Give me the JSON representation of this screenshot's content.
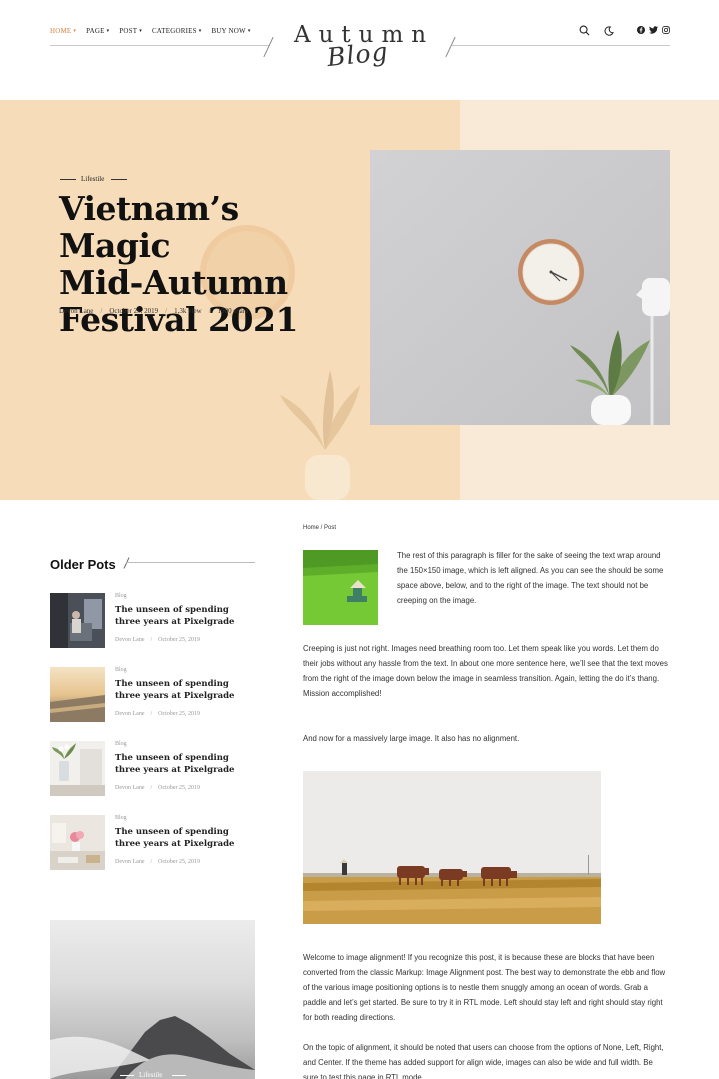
{
  "nav": {
    "items": [
      {
        "label": "HOME",
        "caret": "▾"
      },
      {
        "label": "PAGE",
        "caret": "▾"
      },
      {
        "label": "POST",
        "caret": "▾"
      },
      {
        "label": "CATEGORIES",
        "caret": "▾"
      },
      {
        "label": "BUY NOW",
        "caret": "▾"
      }
    ],
    "active_color": "#d9803e"
  },
  "logo": {
    "main": "Autumn",
    "script": "Blog"
  },
  "icons": {
    "search": "search-icon",
    "dark_mode": "moon-icon",
    "social": [
      "facebook-icon",
      "twitter-icon",
      "instagram-icon"
    ]
  },
  "hero": {
    "category": "Lifestile",
    "title_lines": [
      "Vietnam’s Magic",
      "Mid-Autumn",
      "Festival 2021"
    ],
    "author": "Devon Lane",
    "date": "October 25, 2019",
    "views": "1,3k view",
    "shares": "1900 share",
    "sep": "/",
    "colors": {
      "left_bg": "#f6dcb8",
      "right_bg": "#f8ead7"
    }
  },
  "sidebar": {
    "title": "Older Pots",
    "posts": [
      {
        "category": "Blog",
        "title": "The unseen of spending three years at Pixelgrade",
        "author": "Devon Lane",
        "sep": "/",
        "date": "October 25, 2019"
      },
      {
        "category": "Blog",
        "title": "The unseen of spending three years at Pixelgrade",
        "author": "Devon Lane",
        "sep": "/",
        "date": "October 25, 2019"
      },
      {
        "category": "Blog",
        "title": "The unseen of spending three years at Pixelgrade",
        "author": "Devon Lane",
        "sep": "/",
        "date": "October 25, 2019"
      },
      {
        "category": "Blog",
        "title": "The unseen of spending three years at Pixelgrade",
        "author": "Devon Lane",
        "sep": "/",
        "date": "October 25, 2019"
      }
    ],
    "feature_category": "Lifestile"
  },
  "main": {
    "breadcrumb": "Home / Post",
    "paragraphs": [
      "The rest of this paragraph is filler for the sake of seeing the text wrap around the 150×150 image, which is left aligned. As you can see the should be some space above, below, and to the right of the image. The text should not be creeping on the image.",
      "Creeping is just not right. Images need breathing room too. Let them speak like you words. Let them do their jobs without any hassle from the text. In about one more sentence here, we’ll see that the text moves from the right of the image down below the image in seamless transition. Again, letting the do it’s thang. Mission accomplished!",
      "And now for a massively large image. It also has no alignment.",
      "Welcome to image alignment! If you recognize this post, it is because these are blocks that have been converted from the classic Markup: Image Alignment post. The best way to demonstrate the ebb and flow of the various image positioning options is to nestle them snuggly among an ocean of words. Grab a paddle and let’s get started. Be sure to try it in RTL mode. Left should stay left and right should stay right for both reading directions.",
      "On the topic of alignment, it should be noted that users can choose from the options of None, Left, Right, and Center. If the theme has added support for align wide, images can also be wide and full width. Be sure to test this page in RTL mode."
    ]
  }
}
